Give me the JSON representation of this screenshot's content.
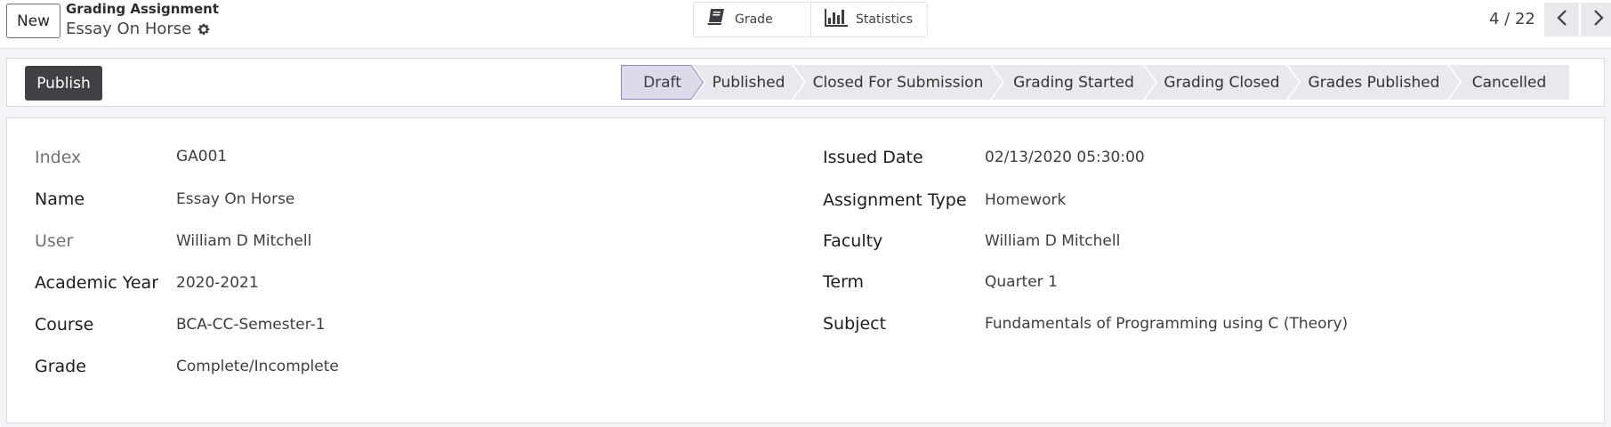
{
  "header": {
    "new_label": "New",
    "breadcrumb_parent": "Grading Assignment",
    "record_title": "Essay On Horse",
    "smart_buttons": [
      {
        "label": "Grade",
        "icon": "book-icon"
      },
      {
        "label": "Statistics",
        "icon": "bar-chart-icon"
      }
    ],
    "pager": "4 / 22"
  },
  "statusbar": {
    "publish_label": "Publish",
    "stages": [
      "Draft",
      "Published",
      "Closed For Submission",
      "Grading Started",
      "Grading Closed",
      "Grades Published",
      "Cancelled"
    ],
    "active_stage": "Draft"
  },
  "form": {
    "left": [
      {
        "label": "Index",
        "value": "GA001",
        "muted": true
      },
      {
        "label": "Name",
        "value": "Essay On Horse",
        "muted": false
      },
      {
        "label": "User",
        "value": "William D Mitchell",
        "muted": true
      },
      {
        "label": "Academic Year",
        "value": "2020-2021",
        "muted": false
      },
      {
        "label": "Course",
        "value": "BCA-CC-Semester-1",
        "muted": false
      },
      {
        "label": "Grade",
        "value": "Complete/Incomplete",
        "muted": false
      }
    ],
    "right": [
      {
        "label": "Issued Date",
        "value": "02/13/2020 05:30:00"
      },
      {
        "label": "Assignment Type",
        "value": "Homework"
      },
      {
        "label": "Faculty",
        "value": "William D Mitchell"
      },
      {
        "label": "Term",
        "value": "Quarter 1"
      },
      {
        "label": "Subject",
        "value": "Fundamentals of Programming using C (Theory)"
      }
    ]
  },
  "colors": {
    "active_stage_bg": "#dcdbeb",
    "stage_bg": "#e8e9ee",
    "primary_button": "#3f4145"
  }
}
